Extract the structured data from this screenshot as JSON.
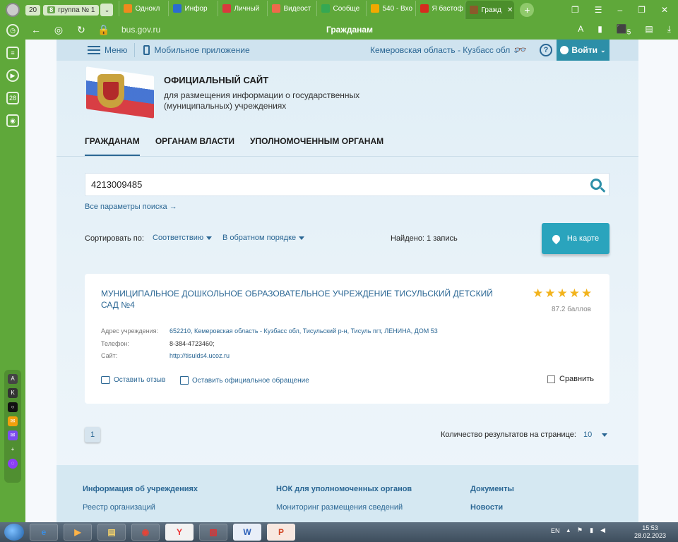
{
  "browser": {
    "tab_count": "20",
    "tab_group": {
      "count": "8",
      "label": "группа № 1"
    },
    "tabs": [
      {
        "label": "Однокл",
        "color": "#ef8a1d"
      },
      {
        "label": "Инфор",
        "color": "#2b6bd1"
      },
      {
        "label": "Личный",
        "color": "#d9393d"
      },
      {
        "label": "Видеост",
        "color": "#f06a4b"
      },
      {
        "label": "Сообще",
        "color": "#35a853"
      },
      {
        "label": "540 - Вхо",
        "color": "#f2a900"
      },
      {
        "label": "Я бастоф",
        "color": "#d52b1e"
      },
      {
        "label": "Гражд",
        "color": "#8a5a2b"
      }
    ],
    "url": "bus.gov.ru",
    "page_title": "Гражданам",
    "badge": "5"
  },
  "site": {
    "topnav": {
      "menu": "Меню",
      "mobile": "Мобильное приложение",
      "region": "Кемеровская область - Кузбасс обл ⌄",
      "login": "Войти"
    },
    "brand": {
      "title": "ОФИЦИАЛЬНЫЙ САЙТ",
      "subtitle": "для размещения информации о государственных (муниципальных) учреждениях"
    },
    "mainnav": [
      "ГРАЖДАНАМ",
      "ОРГАНАМ ВЛАСТИ",
      "УПОЛНОМОЧЕННЫМ ОРГАНАМ"
    ],
    "search": {
      "value": "4213009485",
      "all_params": "Все параметры поиска →"
    },
    "sort": {
      "label": "Сортировать по:",
      "by": "Соответствию",
      "order": "В обратном порядке",
      "found": "Найдено: 1 запись",
      "map_button": "На карте"
    },
    "result": {
      "title": "МУНИЦИПАЛЬНОЕ ДОШКОЛЬНОЕ ОБРАЗОВАТЕЛЬНОЕ УЧРЕЖДЕНИЕ ТИСУЛЬСКИЙ ДЕТСКИЙ САД №4",
      "rating_stars": 5,
      "score": "87.2 баллов",
      "address_label": "Адрес учреждения:",
      "address": "652210, Кемеровская область - Кузбасс обл, Тисульский р-н, Тисуль пгт, ЛЕНИНА, ДОМ 53",
      "phone_label": "Телефон:",
      "phone": "8-384-4723460;",
      "site_label": "Сайт:",
      "site": "http://tisulds4.ucoz.ru",
      "review": "Оставить отзыв",
      "appeal": "Оставить официальное обращение",
      "compare": "Сравнить"
    },
    "pagination": {
      "page": "1",
      "per_page_label": "Количество результатов на странице:",
      "per_page": "10"
    },
    "footer": {
      "col1": [
        "Информация об учреждениях",
        "Реестр организаций"
      ],
      "col2": [
        "НОК для уполномоченных органов",
        "Мониторинг размещения сведений"
      ],
      "col3": [
        "Документы",
        "Новости"
      ]
    }
  },
  "taskbar": {
    "lang": "EN",
    "time": "15:53",
    "date": "28.02.2023"
  }
}
